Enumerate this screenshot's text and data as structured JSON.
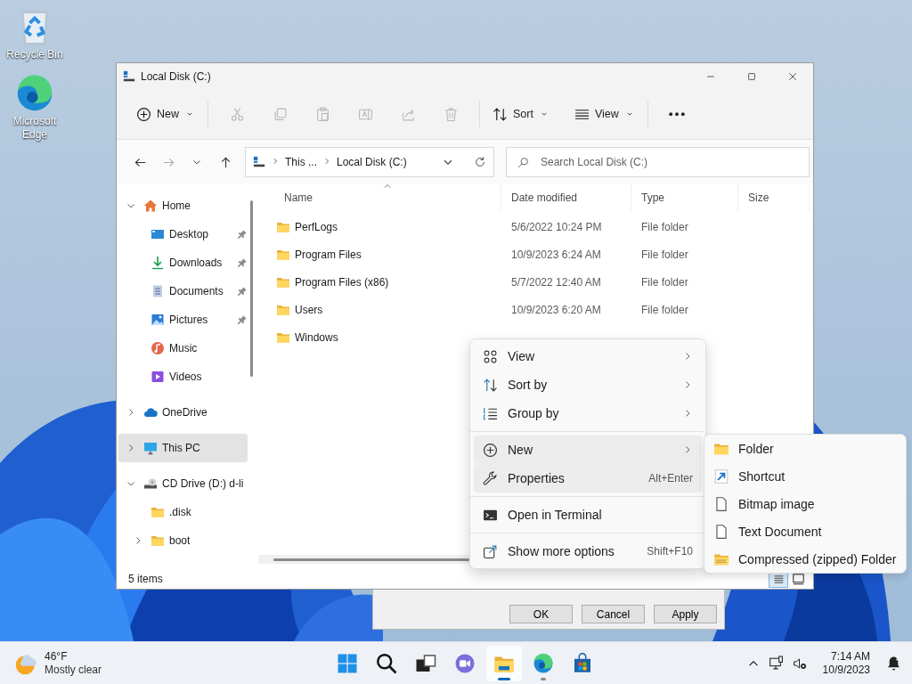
{
  "desktop_icons": [
    {
      "kind": "recycle",
      "label": "Recycle Bin"
    },
    {
      "kind": "edge",
      "label": "Microsoft Edge"
    }
  ],
  "background_dialog": {
    "buttons": [
      "OK",
      "Cancel",
      "Apply"
    ]
  },
  "window": {
    "title": "Local Disk (C:)"
  },
  "toolbar": {
    "new_label": "New",
    "actions": [
      {
        "kind": "cut",
        "disabled": true
      },
      {
        "kind": "copy",
        "disabled": true
      },
      {
        "kind": "paste",
        "disabled": true
      },
      {
        "kind": "rename",
        "disabled": true
      },
      {
        "kind": "share",
        "disabled": true
      },
      {
        "kind": "delete",
        "disabled": true
      }
    ],
    "sort_label": "Sort",
    "view_label": "View"
  },
  "address": {
    "crumbs": [
      "This ...",
      "Local Disk (C:)"
    ],
    "search_placeholder": "Search Local Disk (C:)"
  },
  "sidebar": {
    "items": [
      {
        "kind": "home",
        "label": "Home",
        "expanded": true,
        "selected": false,
        "children": [
          {
            "kind": "desktop",
            "label": "Desktop",
            "pinned": true,
            "selected": false
          },
          {
            "kind": "downloads",
            "label": "Downloads",
            "pinned": true,
            "selected": false
          },
          {
            "kind": "documents",
            "label": "Documents",
            "pinned": true,
            "selected": false
          },
          {
            "kind": "pictures",
            "label": "Pictures",
            "pinned": true,
            "selected": false
          },
          {
            "kind": "music",
            "label": "Music",
            "pinned": false,
            "selected": false
          },
          {
            "kind": "videos",
            "label": "Videos",
            "pinned": false,
            "selected": false
          }
        ]
      },
      {
        "kind": "cloud",
        "label": "OneDrive",
        "expanded": false,
        "selected": false
      },
      {
        "kind": "pc",
        "label": "This PC",
        "expanded": false,
        "selected": true
      },
      {
        "kind": "cd",
        "label": "CD Drive (D:) d-li",
        "expanded": true,
        "selected": false,
        "children": [
          {
            "kind": "folder",
            "label": ".disk",
            "selected": false
          },
          {
            "kind": "folder",
            "label": "boot",
            "expanded": false,
            "selected": false
          }
        ]
      }
    ]
  },
  "table": {
    "columns": [
      {
        "label": "Name",
        "sorted": true
      },
      {
        "label": "Date modified",
        "sorted": false
      },
      {
        "label": "Type",
        "sorted": false
      },
      {
        "label": "Size",
        "sorted": false
      }
    ],
    "rows": [
      {
        "name": "PerfLogs",
        "date": "5/6/2022 10:24 PM",
        "type": "File folder"
      },
      {
        "name": "Program Files",
        "date": "10/9/2023 6:24 AM",
        "type": "File folder"
      },
      {
        "name": "Program Files (x86)",
        "date": "5/7/2022 12:40 AM",
        "type": "File folder"
      },
      {
        "name": "Users",
        "date": "10/9/2023 6:20 AM",
        "type": "File folder"
      },
      {
        "name": "Windows"
      }
    ]
  },
  "status_bar": {
    "text": "5 items",
    "views": [
      {
        "kind": "details",
        "selected": true
      },
      {
        "kind": "tiles",
        "selected": false
      }
    ]
  },
  "context_menu": {
    "items": [
      {
        "kind": "view",
        "label": "View",
        "submenu": true,
        "highlighted": false
      },
      {
        "kind": "sort",
        "label": "Sort by",
        "submenu": true,
        "highlighted": false
      },
      {
        "kind": "group",
        "label": "Group by",
        "submenu": true,
        "highlighted": false
      },
      {
        "kind": "separator"
      },
      {
        "kind": "new",
        "label": "New",
        "submenu": true,
        "highlighted": true
      },
      {
        "kind": "properties",
        "label": "Properties",
        "shortcut": "Alt+Enter",
        "submenu": false,
        "highlighted": true
      },
      {
        "kind": "separator"
      },
      {
        "kind": "terminal",
        "label": "Open in Terminal",
        "submenu": false,
        "highlighted": false
      },
      {
        "kind": "separator"
      },
      {
        "kind": "more",
        "label": "Show more options",
        "shortcut": "Shift+F10",
        "submenu": false,
        "highlighted": false
      }
    ]
  },
  "submenu": {
    "items": [
      {
        "kind": "folder",
        "label": "Folder"
      },
      {
        "kind": "shortcut",
        "label": "Shortcut"
      },
      {
        "kind": "file",
        "label": "Bitmap image"
      },
      {
        "kind": "file",
        "label": "Text Document"
      },
      {
        "kind": "zip",
        "label": "Compressed (zipped) Folder"
      }
    ]
  },
  "taskbar": {
    "weather": {
      "temperature": "46°F",
      "condition": "Mostly clear"
    },
    "apps": [
      {
        "kind": "start",
        "running": false,
        "active": false
      },
      {
        "kind": "search",
        "running": false,
        "active": false
      },
      {
        "kind": "taskview",
        "running": false,
        "active": false
      },
      {
        "kind": "chat",
        "running": false,
        "active": false
      },
      {
        "kind": "explorer",
        "running": true,
        "active": true
      },
      {
        "kind": "edge",
        "running": true,
        "active": false
      },
      {
        "kind": "store",
        "running": false,
        "active": false
      }
    ],
    "time": "7:14 AM",
    "date": "10/9/2023"
  }
}
